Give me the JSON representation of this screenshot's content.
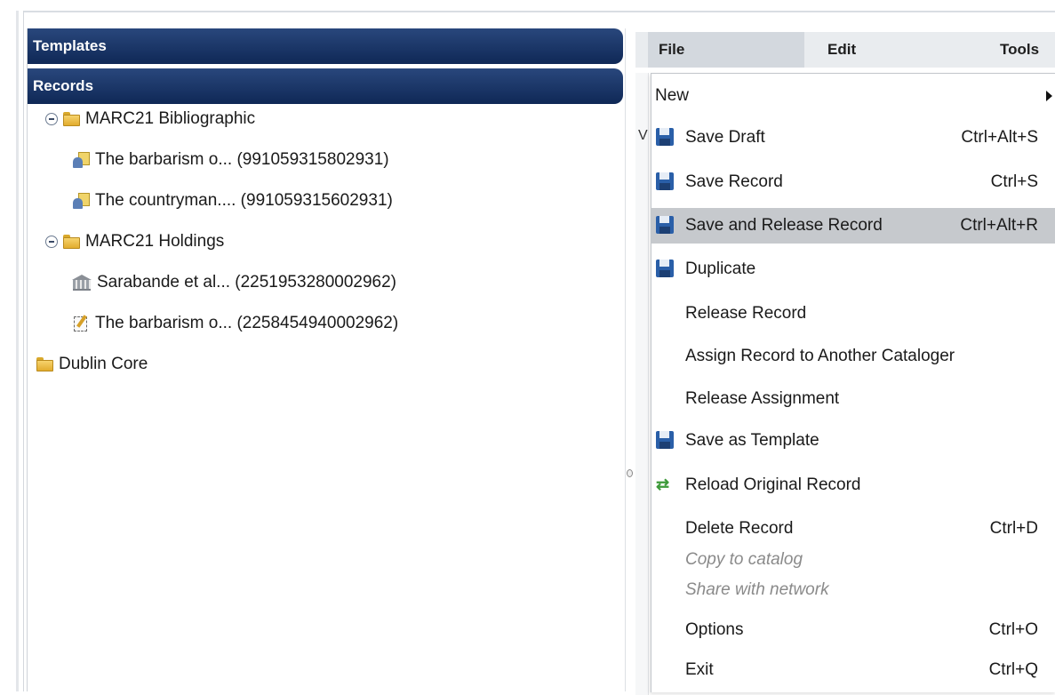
{
  "left_panel": {
    "templates_header": "Templates",
    "records_header": "Records",
    "tree": [
      {
        "label": "MARC21 Bibliographic",
        "icon": "folder-icon",
        "expanded": true
      },
      {
        "label": "The barbarism o... (991059315802931)",
        "icon": "record-icon"
      },
      {
        "label": "The countryman.... (991059315602931)",
        "icon": "record-icon"
      },
      {
        "label": "MARC21 Holdings",
        "icon": "folder-icon",
        "expanded": true
      },
      {
        "label": "Sarabande et al... (2251953280002962)",
        "icon": "holdings-icon"
      },
      {
        "label": "The barbarism o... (2258454940002962)",
        "icon": "edit-record-icon"
      },
      {
        "label": "Dublin Core",
        "icon": "folder-icon"
      }
    ]
  },
  "menubar": {
    "file": "File",
    "edit": "Edit",
    "tools": "Tools"
  },
  "file_menu": {
    "items": [
      {
        "label": "New",
        "shortcut": "",
        "icon": "submenu-arrow"
      },
      {
        "label": "Save Draft",
        "shortcut": "Ctrl+Alt+S",
        "icon": "save-icon"
      },
      {
        "label": "Save Record",
        "shortcut": "Ctrl+S",
        "icon": "save-icon"
      },
      {
        "label": "Save and Release Record",
        "shortcut": "Ctrl+Alt+R",
        "icon": "save-icon",
        "highlighted": true
      },
      {
        "label": "Duplicate",
        "shortcut": "",
        "icon": "save-icon"
      },
      {
        "label": "Release Record",
        "shortcut": ""
      },
      {
        "label": "Assign Record to Another Cataloger",
        "shortcut": ""
      },
      {
        "label": "Release Assignment",
        "shortcut": ""
      },
      {
        "label": "Save as Template",
        "shortcut": "",
        "icon": "save-icon"
      },
      {
        "label": "Reload Original Record",
        "shortcut": "",
        "icon": "reload-icon"
      },
      {
        "label": "Delete Record",
        "shortcut": "Ctrl+D"
      },
      {
        "label": "Copy to catalog",
        "shortcut": "",
        "disabled": true
      },
      {
        "label": "Share with network",
        "shortcut": "",
        "disabled": true
      },
      {
        "label": "Options",
        "shortcut": "Ctrl+O"
      },
      {
        "label": "Exit",
        "shortcut": "Ctrl+Q"
      }
    ]
  },
  "background": {
    "partial_char": "V"
  }
}
